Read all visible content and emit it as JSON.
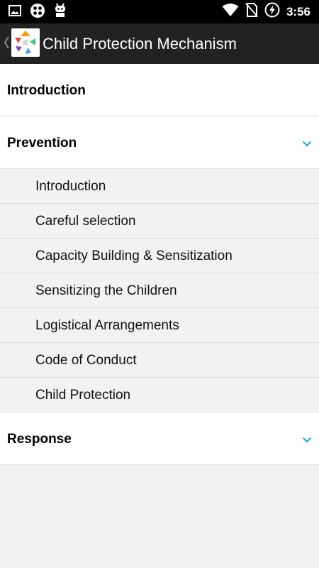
{
  "status_bar": {
    "time": "3:56",
    "icons_left": [
      "gallery-icon",
      "app-grid-icon",
      "android-debug-icon"
    ],
    "icons_right": [
      "wifi-icon",
      "no-sim-icon",
      "battery-charging-icon"
    ]
  },
  "action_bar": {
    "title": "Child Protection Mechanism",
    "icon": "app-logo-icon"
  },
  "menu": {
    "groups": [
      {
        "label": "Introduction",
        "expandable": false
      },
      {
        "label": "Prevention",
        "expandable": true,
        "expanded": true,
        "items": [
          {
            "label": "Introduction"
          },
          {
            "label": "Careful selection"
          },
          {
            "label": "Capacity Building & Sensitization"
          },
          {
            "label": "Sensitizing the Children"
          },
          {
            "label": "Logistical Arrangements"
          },
          {
            "label": "Code of Conduct"
          },
          {
            "label": "Child Protection"
          }
        ]
      },
      {
        "label": "Response",
        "expandable": true,
        "expanded": false
      }
    ]
  },
  "colors": {
    "accent": "#29a9e0",
    "action_bar": "#222222",
    "status_bar": "#000000",
    "sub_item_bg": "#f2f2f2",
    "group_bg": "#ffffff"
  }
}
